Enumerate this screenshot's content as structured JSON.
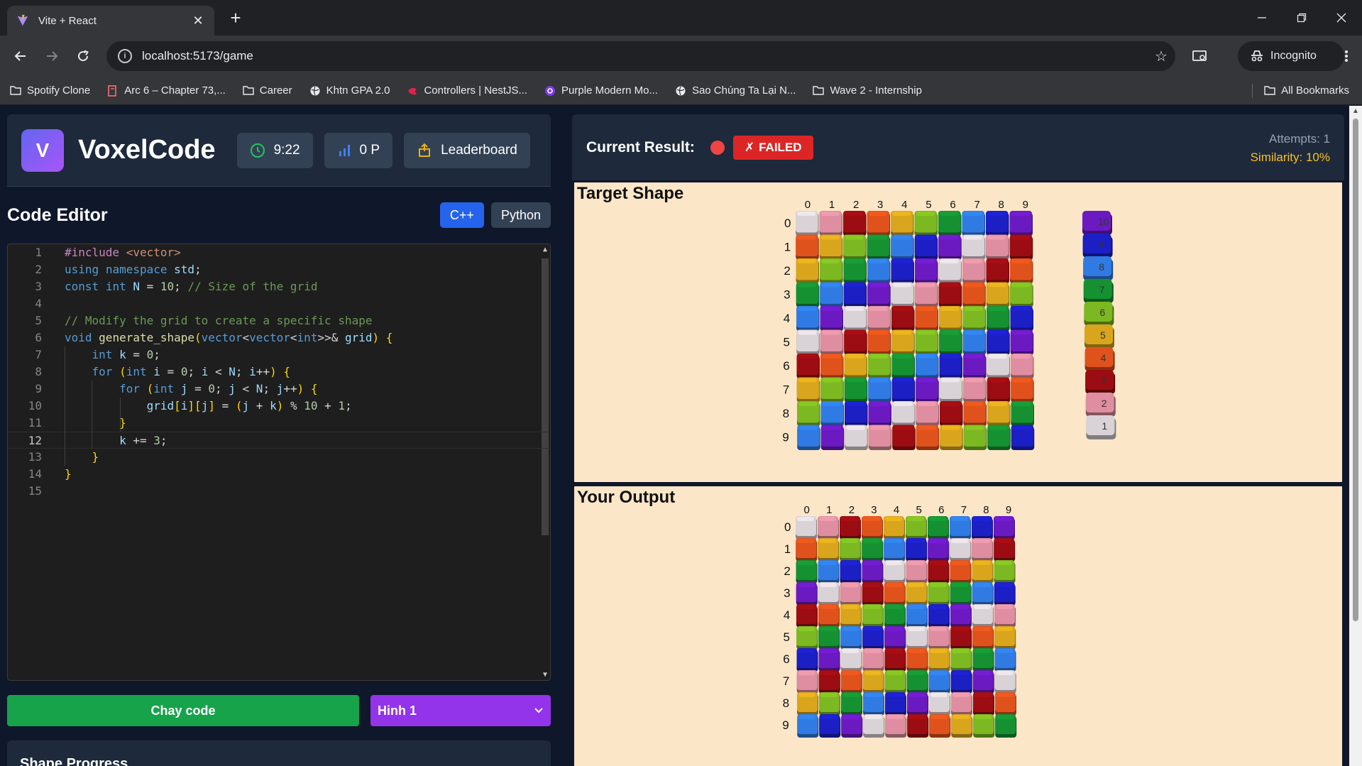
{
  "browser": {
    "tab_title": "Vite + React",
    "url": "localhost:5173/game",
    "incognito_label": "Incognito",
    "bookmarks": [
      {
        "label": "Spotify Clone",
        "icon": "folder-icon"
      },
      {
        "label": "Arc 6 – Chapter 73,...",
        "icon": "book-icon"
      },
      {
        "label": "Career",
        "icon": "folder-icon"
      },
      {
        "label": "Khtn GPA 2.0",
        "icon": "globe-icon"
      },
      {
        "label": "Controllers | NestJS...",
        "icon": "nestjs-icon"
      },
      {
        "label": "Purple Modern Mo...",
        "icon": "canva-icon"
      },
      {
        "label": "Sao Chúng Ta Lại N...",
        "icon": "globe-icon"
      },
      {
        "label": "Wave 2 - Internship",
        "icon": "folder-icon"
      }
    ],
    "all_bookmarks_label": "All Bookmarks"
  },
  "app": {
    "logo_letter": "V",
    "name": "VoxelCode",
    "timer": "9:22",
    "points": "0 P",
    "leaderboard_label": "Leaderboard"
  },
  "editor": {
    "title": "Code Editor",
    "languages": [
      "C++",
      "Python"
    ],
    "active_language": "C++",
    "current_line": 12,
    "code_lines": [
      "#include <vector>",
      "using namespace std;",
      "const int N = 10; // Size of the grid",
      "",
      "// Modify the grid to create a specific shape",
      "void generate_shape(vector<vector<int>>& grid) {",
      "    int k = 0;",
      "    for (int i = 0; i < N; i++) {",
      "        for (int j = 0; j < N; j++) {",
      "            grid[i][j] = (j + k) % 10 + 1;",
      "        }",
      "        k += 3;",
      "    }",
      "}",
      ""
    ]
  },
  "actions": {
    "run_label": "Chay code",
    "shape_selected": "Hinh 1"
  },
  "progress": {
    "title": "Shape Progress"
  },
  "result": {
    "label": "Current Result:",
    "status": "FAILED",
    "status_icon": "x-mark",
    "attempts": "Attempts: 1",
    "similarity": "Similarity: 10%"
  },
  "target": {
    "title": "Target Shape",
    "legend": [
      "10",
      "9",
      "8",
      "7",
      "6",
      "5",
      "4",
      "3",
      "2",
      "1"
    ],
    "grid": [
      [
        1,
        2,
        3,
        4,
        5,
        6,
        7,
        8,
        9,
        10
      ],
      [
        4,
        5,
        6,
        7,
        8,
        9,
        10,
        1,
        2,
        3
      ],
      [
        5,
        6,
        7,
        8,
        9,
        10,
        1,
        2,
        3,
        4
      ],
      [
        7,
        8,
        9,
        10,
        1,
        2,
        3,
        4,
        5,
        6
      ],
      [
        8,
        10,
        1,
        2,
        3,
        4,
        5,
        6,
        7,
        9
      ],
      [
        1,
        2,
        3,
        4,
        5,
        6,
        7,
        8,
        9,
        10
      ],
      [
        3,
        4,
        5,
        6,
        7,
        8,
        9,
        10,
        1,
        2
      ],
      [
        5,
        6,
        7,
        8,
        9,
        10,
        1,
        2,
        3,
        4
      ],
      [
        6,
        8,
        9,
        10,
        1,
        2,
        3,
        4,
        5,
        7
      ],
      [
        8,
        10,
        1,
        2,
        3,
        4,
        5,
        6,
        7,
        9
      ]
    ]
  },
  "output": {
    "title": "Your Output",
    "grid": [
      [
        1,
        2,
        3,
        4,
        5,
        6,
        7,
        8,
        9,
        10
      ],
      [
        4,
        5,
        6,
        7,
        8,
        9,
        10,
        1,
        2,
        3
      ],
      [
        7,
        8,
        9,
        10,
        1,
        2,
        3,
        4,
        5,
        6
      ],
      [
        10,
        1,
        2,
        3,
        4,
        5,
        6,
        7,
        8,
        9
      ],
      [
        3,
        4,
        5,
        6,
        7,
        8,
        9,
        10,
        1,
        2
      ],
      [
        6,
        7,
        8,
        9,
        10,
        1,
        2,
        3,
        4,
        5
      ],
      [
        9,
        10,
        1,
        2,
        3,
        4,
        5,
        6,
        7,
        8
      ],
      [
        2,
        3,
        4,
        5,
        6,
        7,
        8,
        9,
        10,
        1
      ],
      [
        5,
        6,
        7,
        8,
        9,
        10,
        1,
        2,
        3,
        4
      ],
      [
        8,
        9,
        10,
        1,
        2,
        3,
        4,
        5,
        6,
        7
      ]
    ]
  },
  "colors": {
    "cubes": {
      "1": "#d9d2d6",
      "2": "#de8ea0",
      "3": "#9b0d12",
      "4": "#e0521c",
      "5": "#d8a51c",
      "6": "#7cb821",
      "7": "#159132",
      "8": "#2f7be3",
      "9": "#1b1fc4",
      "10": "#6b1ac2"
    },
    "accent": "#2563eb",
    "fail": "#dc2626",
    "run": "#16a34a",
    "select": "#9333ea"
  }
}
